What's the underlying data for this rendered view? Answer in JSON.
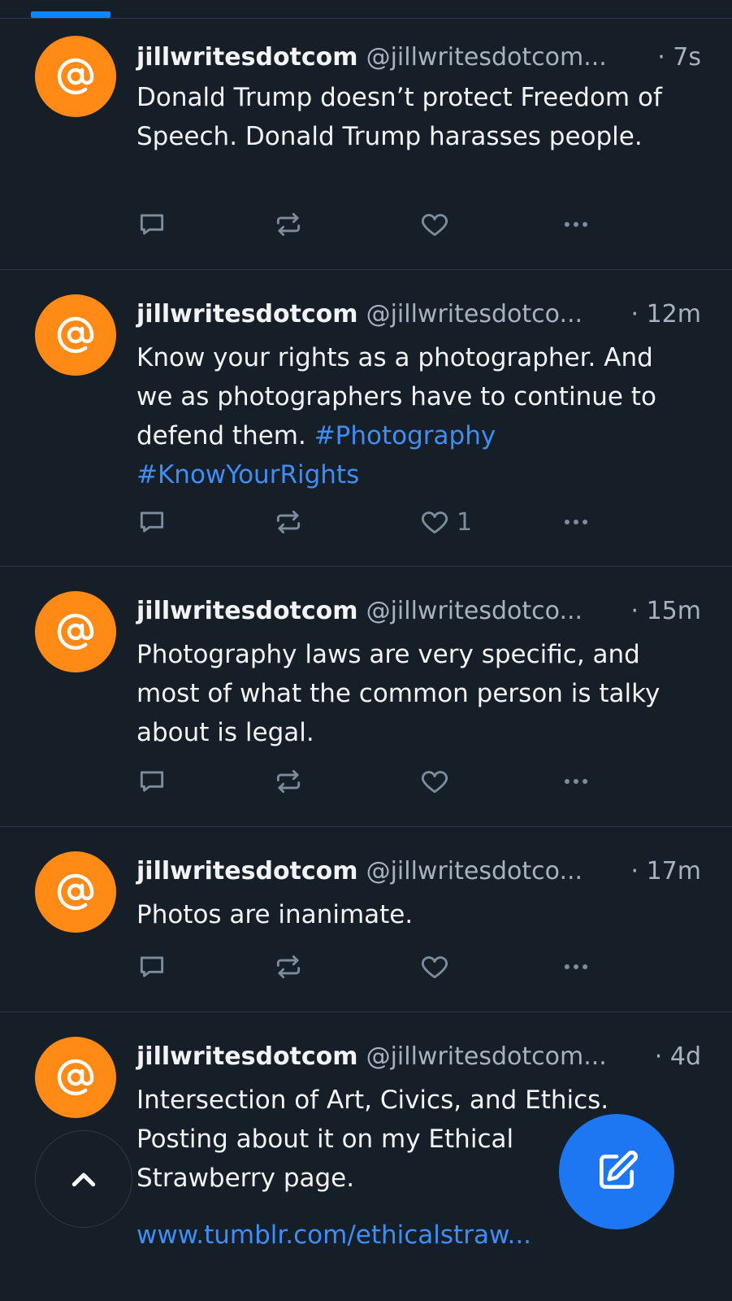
{
  "colors": {
    "background": "#161e27",
    "accent": "#1083fe",
    "avatar": "#ff8a16",
    "link": "#3e8ef7",
    "muted": "#a7b2bf"
  },
  "icons": {
    "avatar": "at-sign-icon",
    "reply": "speech-bubble-icon",
    "repost": "repost-arrows-icon",
    "like": "heart-icon",
    "more": "ellipsis-icon",
    "scroll_top": "chevron-up-icon",
    "compose": "pencil-square-icon"
  },
  "posts": [
    {
      "display_name": "jillwritesdotcom",
      "handle": "@jillwritesdotcom...",
      "time": "· 7s",
      "text": "Donald Trump doesn’t protect Freedom of Speech. Donald Trump harasses people.",
      "like_count": ""
    },
    {
      "display_name": "jillwritesdotcom",
      "handle": "@jillwritesdotco...",
      "time": "· 12m",
      "text": "Know your rights as a photographer. And we as photographers have to continue to defend them.",
      "hashtag_1": "#Photography",
      "hashtag_2": "#KnowYourRights",
      "like_count": "1"
    },
    {
      "display_name": "jillwritesdotcom",
      "handle": "@jillwritesdotco...",
      "time": "· 15m",
      "text": "Photography laws are very specific, and most of what the common person is talky about is legal.",
      "like_count": ""
    },
    {
      "display_name": "jillwritesdotcom",
      "handle": "@jillwritesdotco...",
      "time": "· 17m",
      "text": "Photos are inanimate.",
      "like_count": ""
    },
    {
      "display_name": "jillwritesdotcom",
      "handle": "@jillwritesdotcom...",
      "time": "· 4d",
      "text_line_1": "Intersection of Art, Civics, and Ethics.",
      "text_line_2": "Posting about it on my Ethical",
      "text_line_3": "Strawberry page.",
      "link": "www.tumblr.com/ethicalstraw..."
    }
  ]
}
